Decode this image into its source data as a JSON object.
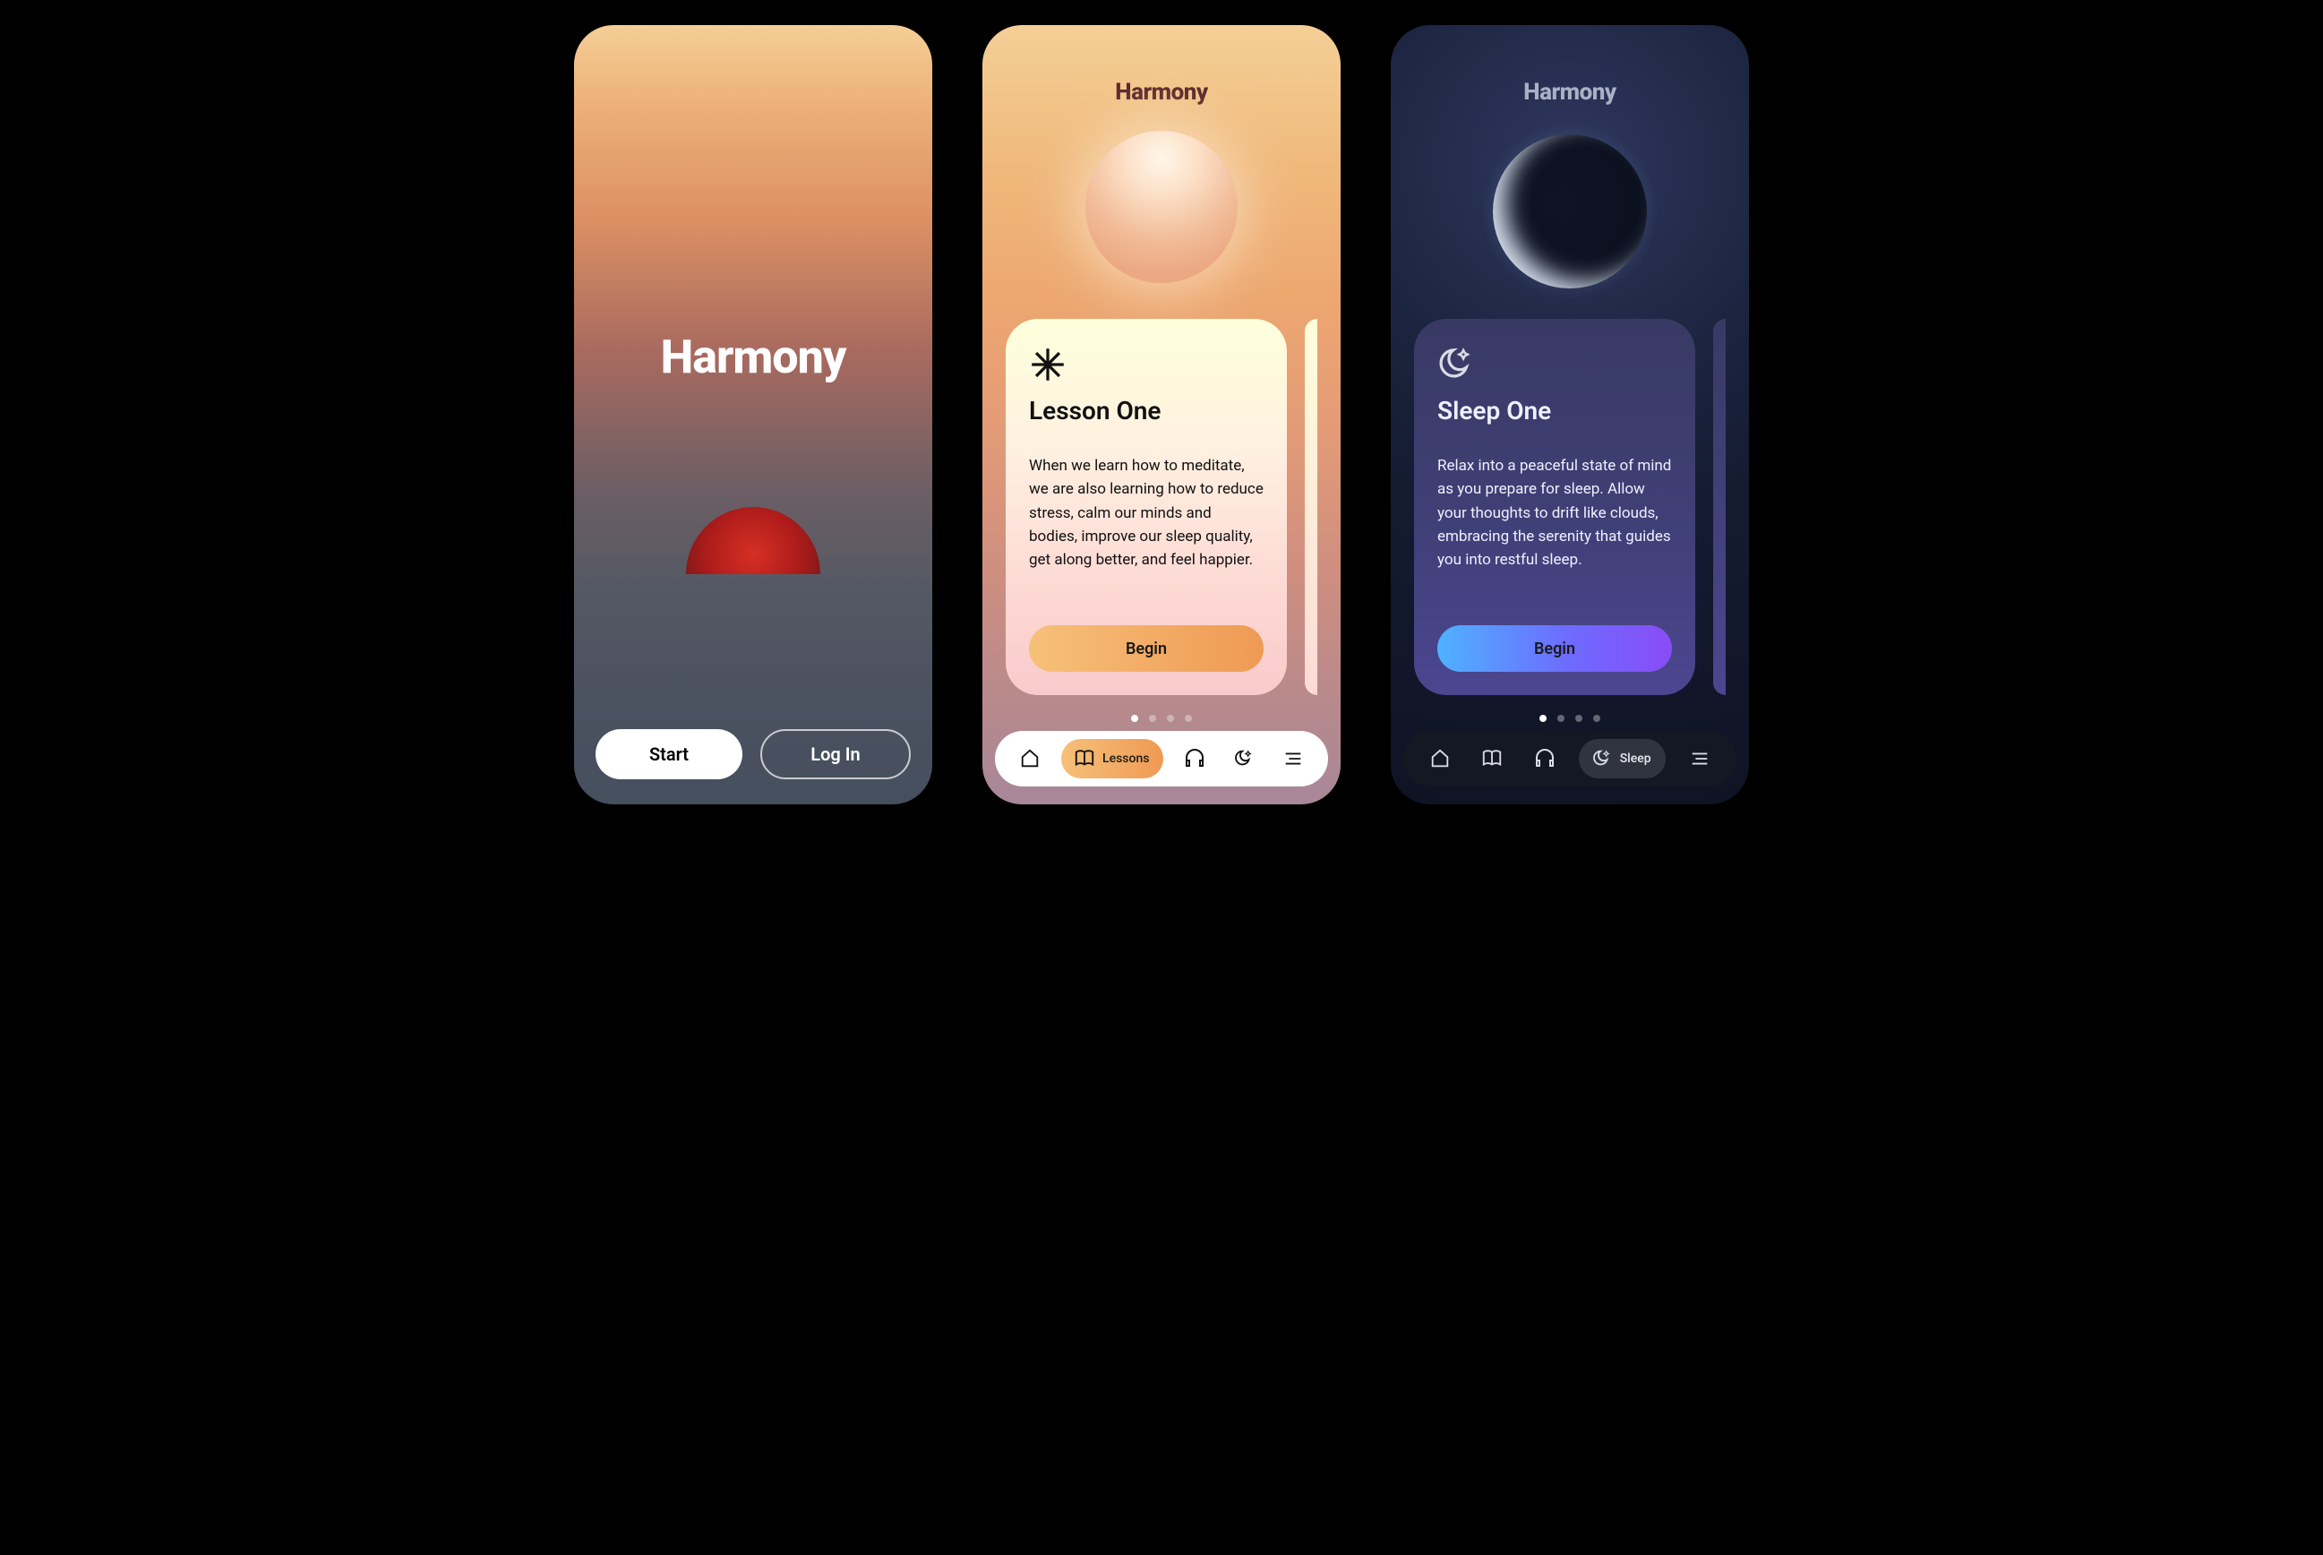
{
  "brand": "Harmony",
  "splash": {
    "start": "Start",
    "login": "Log In"
  },
  "lessons": {
    "card": {
      "title": "Lesson One",
      "body": "When we learn how to meditate, we are also learning how to reduce stress, calm our minds and bodies, improve our sleep quality, get along better, and feel happier.",
      "cta": "Begin"
    },
    "active_tab_label": "Lessons",
    "dot_count": 4,
    "active_dot": 0
  },
  "sleep": {
    "card": {
      "title": "Sleep One",
      "body": "Relax into a peaceful state of mind as you prepare for sleep. Allow your thoughts to drift like clouds, embracing the serenity that guides you into restful sleep.",
      "cta": "Begin"
    },
    "active_tab_label": "Sleep",
    "dot_count": 4,
    "active_dot": 0
  },
  "tabs": {
    "home": "home-icon",
    "lessons": "book-icon",
    "listen": "headphones-icon",
    "sleep": "moon-star-icon",
    "menu": "menu-icon"
  }
}
